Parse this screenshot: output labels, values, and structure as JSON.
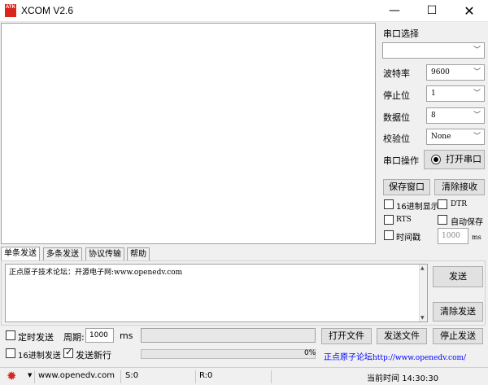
{
  "window": {
    "logo_text": "ATK",
    "title": "XCOM V2.6",
    "minimize_glyph": "—",
    "maximize_glyph": "☐",
    "close_glyph": "✕"
  },
  "receive": {
    "text": ""
  },
  "port_panel": {
    "port_select_label": "串口选择",
    "port_value": "",
    "baud_label": "波特率",
    "baud_value": "9600",
    "stop_label": "停止位",
    "stop_value": "1",
    "data_label": "数据位",
    "data_value": "8",
    "parity_label": "校验位",
    "parity_value": "None",
    "operation_label": "串口操作",
    "open_port_label": "打开串口",
    "save_window_label": "保存窗口",
    "clear_receive_label": "清除接收",
    "hex_display_label": "16进制显示",
    "hex_display_checked": false,
    "dtr_label": "DTR",
    "dtr_checked": false,
    "rts_label": "RTS",
    "rts_checked": false,
    "auto_save_label": "自动保存",
    "auto_save_checked": false,
    "timestamp_label": "时间戳",
    "timestamp_checked": false,
    "timestamp_value": "1000",
    "timestamp_unit": "ms"
  },
  "tabs": [
    {
      "label": "单条发送",
      "active": true
    },
    {
      "label": "多条发送",
      "active": false
    },
    {
      "label": "协议传输",
      "active": false
    },
    {
      "label": "帮助",
      "active": false
    }
  ],
  "send": {
    "text": "正点原子技术论坛：开源电子网:www.openedv.com",
    "send_label": "发送",
    "clear_send_label": "清除发送",
    "timed_send_label": "定时发送",
    "timed_send_checked": false,
    "period_label": "周期:",
    "period_value": "1000",
    "period_unit": "ms",
    "file_path": "",
    "open_file_label": "打开文件",
    "send_file_label": "发送文件",
    "stop_send_label": "停止发送",
    "hex_send_label": "16进制发送",
    "hex_send_checked": false,
    "newline_label": "发送新行",
    "newline_checked": true,
    "progress_text": "0%",
    "progress_fraction": 0,
    "forum_text": "正点原子论坛",
    "forum_url": "http://www.openedv.com/"
  },
  "status": {
    "dropdown_glyph": "▼",
    "website": "www.openedv.com",
    "sent": "S:0",
    "received": "R:0",
    "time_label": "当前时间",
    "time_value": "14:30:30"
  }
}
